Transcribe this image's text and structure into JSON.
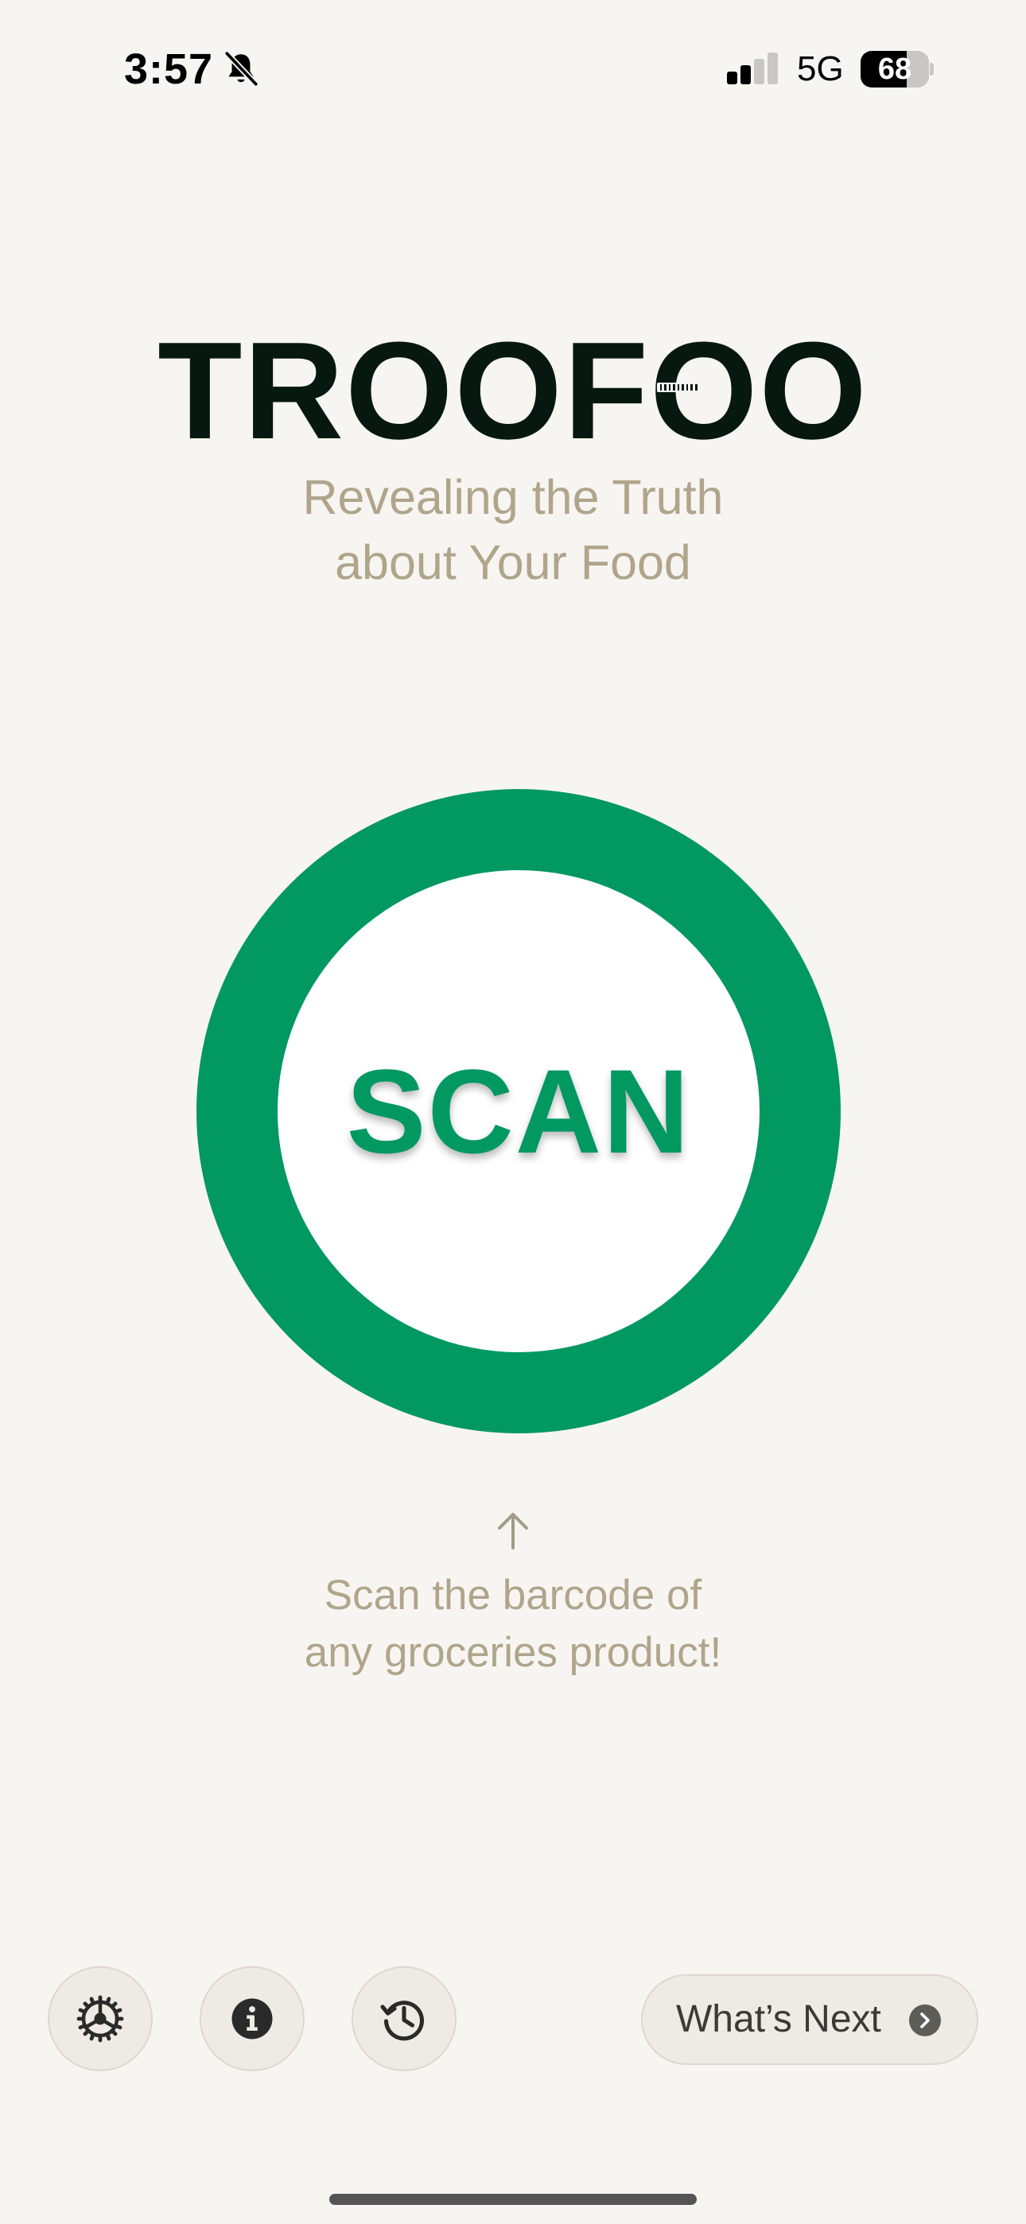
{
  "status_bar": {
    "time": "3:57",
    "network": "5G",
    "battery_level": "68",
    "icons": [
      "bell-slash-icon",
      "cellular-signal-icon",
      "battery-icon"
    ]
  },
  "brand": {
    "title": "TROOFOO",
    "tagline_line1": "Revealing the Truth",
    "tagline_line2": "about Your Food"
  },
  "scan": {
    "label": "SCAN"
  },
  "hint": {
    "line1": "Scan the barcode of",
    "line2": "any groceries product!",
    "icon": "arrow-up-icon"
  },
  "toolbar": {
    "buttons": [
      {
        "icon": "settings-gear-icon"
      },
      {
        "icon": "info-icon"
      },
      {
        "icon": "history-icon"
      }
    ],
    "next_label": "What’s Next",
    "next_icon": "chevron-right-icon"
  },
  "colors": {
    "background": "#f7f5f1",
    "accent": "#029862",
    "tagline": "#b0a58b",
    "title": "#06180f",
    "button_bg": "#eeebe4"
  }
}
